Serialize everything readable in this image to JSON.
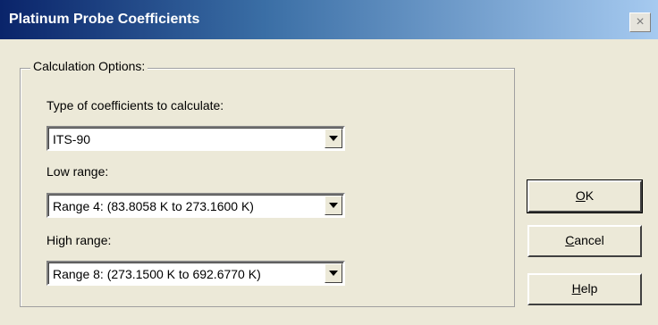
{
  "window": {
    "title": "Platinum Probe Coefficients",
    "close_glyph": "×"
  },
  "group": {
    "label": "Calculation Options:"
  },
  "fields": [
    {
      "label": "Type of coefficients to calculate:",
      "value": "ITS-90"
    },
    {
      "label": "Low range:",
      "value": "Range 4:  (83.8058 K to 273.1600 K)"
    },
    {
      "label": "High range:",
      "value": "Range 8:  (273.1500 K to 692.6770 K)"
    }
  ],
  "buttons": {
    "ok": {
      "mnemonic": "O",
      "rest": "K"
    },
    "cancel": {
      "mnemonic": "C",
      "rest": "ancel"
    },
    "help": {
      "mnemonic": "H",
      "rest": "elp"
    }
  },
  "colors": {
    "titlebar_start": "#0a246a",
    "titlebar_end": "#a6caf0",
    "face": "#ece9d8"
  }
}
